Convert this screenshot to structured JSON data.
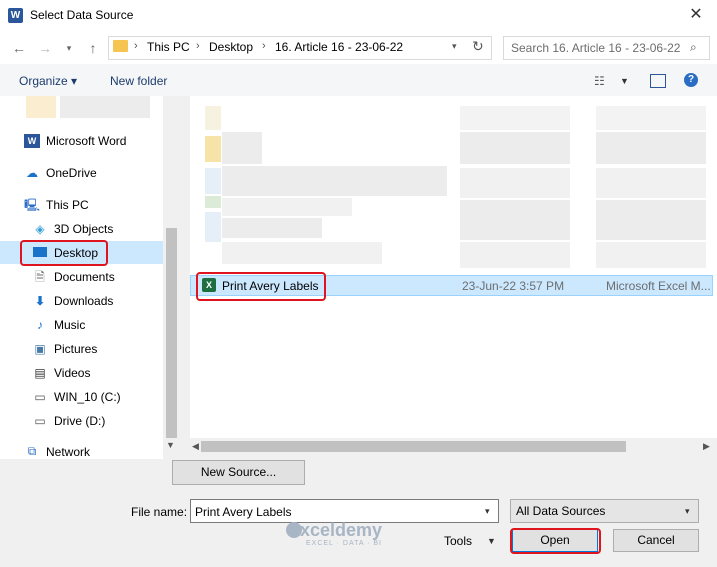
{
  "window": {
    "title": "Select Data Source",
    "app_icon": "W"
  },
  "address": {
    "crumbs": [
      "This PC",
      "Desktop",
      "16. Article 16 - 23-06-22"
    ],
    "search_placeholder": "Search 16. Article 16 - 23-06-22"
  },
  "toolbar": {
    "organize": "Organize ▾",
    "new_folder": "New folder"
  },
  "nav": {
    "items": [
      {
        "label": "Microsoft Word",
        "icon": "word-icon"
      },
      {
        "label": "OneDrive",
        "icon": "cloud-icon"
      },
      {
        "label": "This PC",
        "icon": "pc-icon"
      },
      {
        "label": "3D Objects",
        "icon": "cube-icon"
      },
      {
        "label": "Desktop",
        "icon": "desktop-icon"
      },
      {
        "label": "Documents",
        "icon": "documents-icon"
      },
      {
        "label": "Downloads",
        "icon": "download-icon"
      },
      {
        "label": "Music",
        "icon": "music-icon"
      },
      {
        "label": "Pictures",
        "icon": "pictures-icon"
      },
      {
        "label": "Videos",
        "icon": "videos-icon"
      },
      {
        "label": "WIN_10 (C:)",
        "icon": "drive-icon"
      },
      {
        "label": "Drive (D:)",
        "icon": "drive-icon"
      },
      {
        "label": "Network",
        "icon": "network-icon"
      }
    ]
  },
  "files": {
    "selected": {
      "name": "Print Avery Labels",
      "date": "23-Jun-22 3:57 PM",
      "type": "Microsoft Excel M..."
    }
  },
  "bottom": {
    "new_source": "New Source...",
    "file_name_label": "File name:",
    "file_name_value": "Print Avery Labels",
    "filter_value": "All Data Sources",
    "tools": "Tools",
    "open": "Open",
    "cancel": "Cancel"
  },
  "watermark": {
    "name": "exceldemy",
    "tagline": "EXCEL · DATA · BI"
  },
  "colors": {
    "selection": "#cce8ff",
    "highlight": "#e0141e",
    "excel": "#1d6f42"
  }
}
